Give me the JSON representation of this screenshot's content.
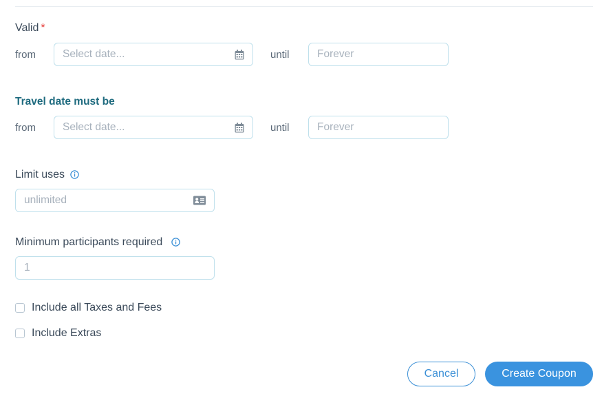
{
  "valid": {
    "label": "Valid",
    "required_mark": "*",
    "from_label": "from",
    "from_placeholder": "Select date...",
    "until_label": "until",
    "until_placeholder": "Forever"
  },
  "travel": {
    "label": "Travel date must be",
    "from_label": "from",
    "from_placeholder": "Select date...",
    "until_label": "until",
    "until_placeholder": "Forever"
  },
  "limit_uses": {
    "label": "Limit uses",
    "placeholder": "unlimited"
  },
  "min_participants": {
    "label": "Minimum participants required",
    "placeholder": "1"
  },
  "checkboxes": [
    {
      "label": "Include all Taxes and Fees",
      "checked": false
    },
    {
      "label": "Include Extras",
      "checked": false
    }
  ],
  "actions": {
    "cancel_label": "Cancel",
    "create_label": "Create Coupon"
  },
  "colors": {
    "accent": "#3a93df",
    "teal_heading": "#1f6b7f",
    "required": "#e53935",
    "field_border": "#bfe0ec"
  },
  "icons": {
    "calendar": "calendar-icon",
    "info": "info-icon",
    "id_card": "id-card-icon"
  }
}
